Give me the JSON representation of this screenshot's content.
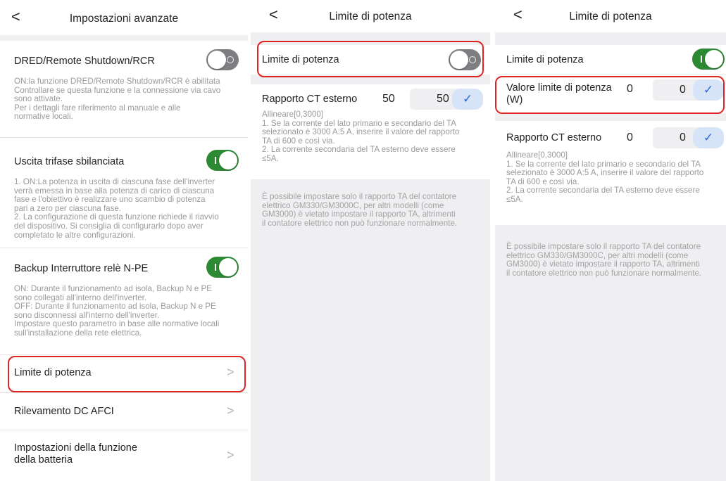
{
  "panel1": {
    "back": "<",
    "title": "Impostazioni avanzate",
    "dred": {
      "title": "DRED/Remote Shutdown/RCR",
      "state": "off",
      "desc": "ON:la funzione DRED/Remote Shutdown/RCR è abilitata\nControllare se questa funzione e la connessione via cavo\nsono attivate.\nPer i dettagli fare riferimento al manuale e alle\nnormative locali."
    },
    "unbalanced": {
      "title": "Uscita trifase sbilanciata",
      "state": "on",
      "desc": "1. ON:La potenza in uscita di ciascuna fase dell'inverter\nverrà emessa in base alla potenza di carico di ciascuna\nfase e l'obiettivo è realizzare uno scambio di potenza\npari a zero per ciascuna fase.\n2. La configurazione di questa funzione richiede il riavvio\ndel dispositivo. Si consiglia di configurarlo dopo aver\ncompletato le altre configurazioni."
    },
    "backup": {
      "title": "Backup Interruttore relè N-PE",
      "state": "on",
      "desc": "ON: Durante il funzionamento ad isola, Backup N e PE\nsono collegati all'interno dell'inverter.\nOFF: Durante il funzionamento ad isola, Backup N e PE\nsono disconnessi all'interno dell'inverter.\nImpostare questo parametro in base alle normative locali\nsull'installazione della rete elettrica."
    },
    "menu": [
      {
        "label": "Limite di potenza"
      },
      {
        "label": "Rilevamento DC AFCI"
      },
      {
        "label": "Impostazioni della funzione\ndella batteria"
      }
    ],
    "chevron": ">"
  },
  "panel2": {
    "back": "<",
    "title": "Limite di potenza",
    "limit_label": "Limite di potenza",
    "limit_state": "off",
    "ct_label": "Rapporto CT esterno",
    "ct_value": "50",
    "ct_input": "50",
    "ct_desc": "Allineare[0,3000]\n1. Se la corrente del lato primario e secondario del TA\nselezionato è 3000 A:5 A, inserire il valore del rapporto\nTA di 600 e così via.\n2. La corrente secondaria del TA esterno deve essere\n≤5A.",
    "note": "È possibile impostare solo il rapporto TA del contatore\nelettrico GM330/GM3000C, per altri modelli (come\nGM3000) è vietato impostare il rapporto TA, altrimenti\nil contatore elettrico non può funzionare normalmente.",
    "check": "✓"
  },
  "panel3": {
    "back": "<",
    "title": "Limite di potenza",
    "limit_label": "Limite di potenza",
    "limit_state": "on",
    "value_label": "Valore limite di potenza\n(W)",
    "value_current": "0",
    "value_input": "0",
    "ct_label": "Rapporto CT esterno",
    "ct_value": "0",
    "ct_input": "0",
    "ct_desc": "Allineare[0,3000]\n1. Se la corrente del lato primario e secondario del TA\nselezionato è 3000 A:5 A, inserire il valore del rapporto\nTA di 600 e così via.\n2. La corrente secondaria del TA esterno deve essere\n≤5A.",
    "note": "È possibile impostare solo il rapporto TA del contatore\nelettrico GM330/GM3000C, per altri modelli (come\nGM3000) è vietato impostare il rapporto TA, altrimenti\nil contatore elettrico non può funzionare normalmente.",
    "check": "✓"
  },
  "colors": {
    "toggle_on": "#2c8a35",
    "toggle_off": "#7d7d82",
    "highlight": "#e02424",
    "confirm_bg": "#d7e4f7",
    "confirm_fg": "#2c66d6"
  }
}
